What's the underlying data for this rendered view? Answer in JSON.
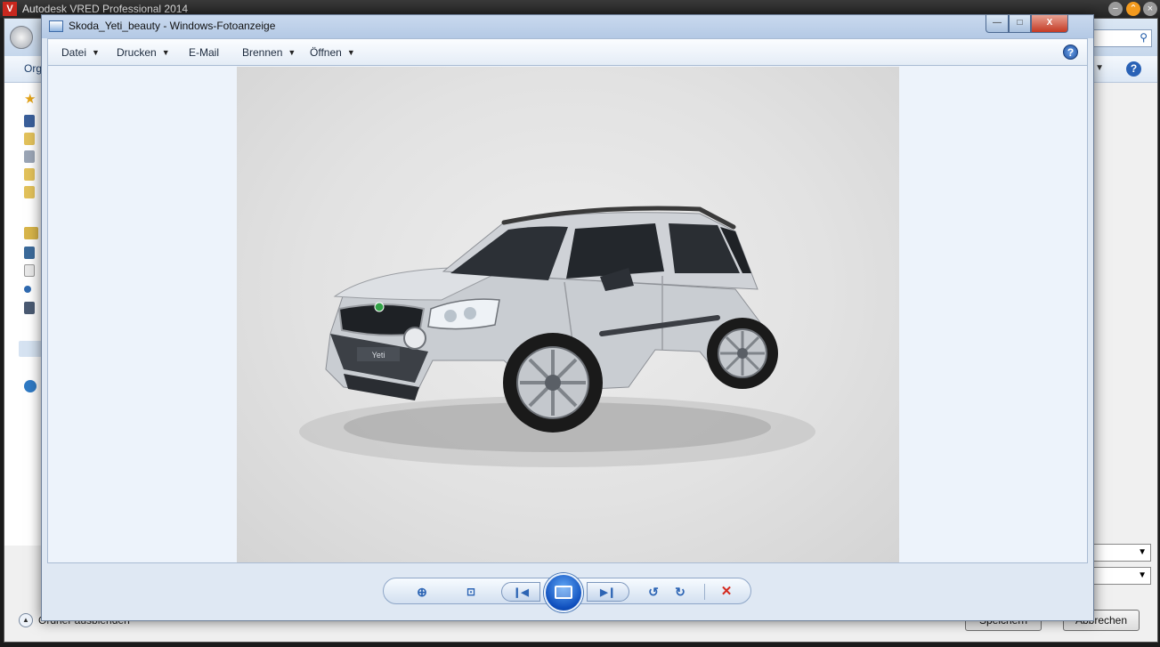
{
  "vred": {
    "title": "Autodesk VRED Professional 2014",
    "logo_letter": "V"
  },
  "background_dialog": {
    "toolbar_label": "Org",
    "hide_folders_label": "Ordner ausblenden",
    "cancel_label": "Abbrechen",
    "save_label": "Speichern"
  },
  "viewer": {
    "title": "Skoda_Yeti_beauty - Windows-Fotoanzeige",
    "menu": [
      {
        "label": "Datei",
        "has_arrow": true
      },
      {
        "label": "Drucken",
        "has_arrow": true
      },
      {
        "label": "E-Mail",
        "has_arrow": false
      },
      {
        "label": "Brennen",
        "has_arrow": true
      },
      {
        "label": "Öffnen",
        "has_arrow": true
      }
    ],
    "help_glyph": "?",
    "close_glyph": "X",
    "photo_plate": "Yeti"
  },
  "icons": {
    "zoom": "⊕",
    "fit": "⊡",
    "prev": "❙◀",
    "next": "▶❙",
    "rotate_left": "↺",
    "rotate_right": "↻",
    "delete": "✕"
  },
  "colors": {
    "accent": "#1d4f9e",
    "delete": "#d42a1f",
    "car_body": "#c9cdd2"
  }
}
